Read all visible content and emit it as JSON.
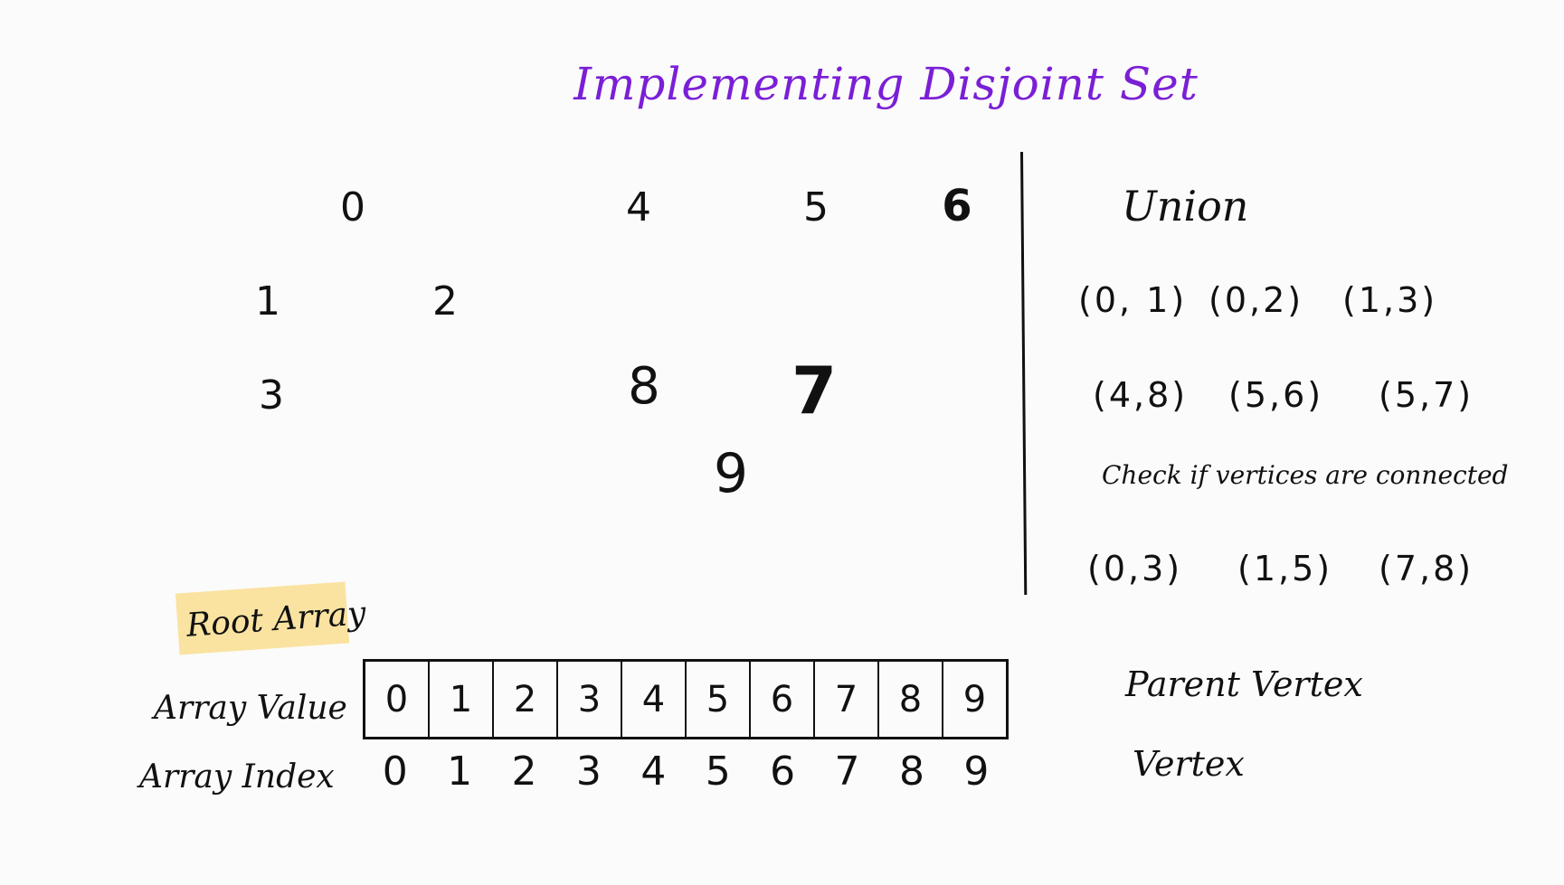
{
  "title": "Implementing Disjoint Set",
  "colors": {
    "title": "#7a1fd6",
    "ink": "#111111",
    "highlight": "#fae3a1",
    "background": "#fbfbfb"
  },
  "nodes": [
    "0",
    "1",
    "2",
    "3",
    "4",
    "5",
    "6",
    "7",
    "8",
    "9"
  ],
  "union": {
    "heading": "Union",
    "row1": [
      "(0, 1)",
      "(0,2)",
      "(1,3)"
    ],
    "row2": [
      "(4,8)",
      "(5,6)",
      "(5,7)"
    ]
  },
  "check": {
    "heading": "Check if vertices are connected",
    "pairs": [
      "(0,3)",
      "(1,5)",
      "(7,8)"
    ]
  },
  "root_array": {
    "label": "Root Array",
    "value_label": "Array Value",
    "index_label": "Array Index",
    "values": [
      "0",
      "1",
      "2",
      "3",
      "4",
      "5",
      "6",
      "7",
      "8",
      "9"
    ],
    "indices": [
      "0",
      "1",
      "2",
      "3",
      "4",
      "5",
      "6",
      "7",
      "8",
      "9"
    ]
  },
  "legend": {
    "parent": "Parent Vertex",
    "vertex": "Vertex"
  }
}
